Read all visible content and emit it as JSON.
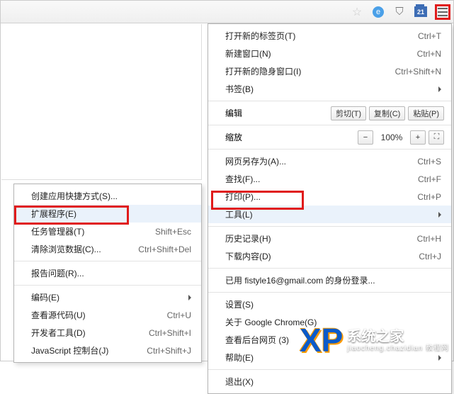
{
  "toolbar": {
    "calendar_num": "21"
  },
  "main": {
    "newtab": {
      "label": "打开新的标签页(T)",
      "shortcut": "Ctrl+T"
    },
    "newwin": {
      "label": "新建窗口(N)",
      "shortcut": "Ctrl+N"
    },
    "incog": {
      "label": "打开新的隐身窗口(I)",
      "shortcut": "Ctrl+Shift+N"
    },
    "bookmarks": {
      "label": "书签(B)"
    },
    "edit": {
      "label": "编辑",
      "cut": "剪切(T)",
      "copy": "复制(C)",
      "paste": "粘贴(P)"
    },
    "zoom": {
      "label": "缩放",
      "minus": "−",
      "pct": "100%",
      "plus": "+"
    },
    "saveas": {
      "label": "网页另存为(A)...",
      "shortcut": "Ctrl+S"
    },
    "find": {
      "label": "查找(F)...",
      "shortcut": "Ctrl+F"
    },
    "print": {
      "label": "打印(P)...",
      "shortcut": "Ctrl+P"
    },
    "tools": {
      "label": "工具(L)"
    },
    "history": {
      "label": "历史记录(H)",
      "shortcut": "Ctrl+H"
    },
    "downloads": {
      "label": "下载内容(D)",
      "shortcut": "Ctrl+J"
    },
    "signedin": {
      "label": "已用 fistyle16@gmail.com 的身份登录..."
    },
    "settings": {
      "label": "设置(S)"
    },
    "about": {
      "label": "关于 Google Chrome(G)"
    },
    "taskpage": {
      "label": "查看后台网页 (3)"
    },
    "help": {
      "label": "帮助(E)"
    },
    "exit": {
      "label": "退出(X)"
    }
  },
  "sub": {
    "shortcut": {
      "label": "创建应用快捷方式(S)..."
    },
    "extensions": {
      "label": "扩展程序(E)"
    },
    "taskmgr": {
      "label": "任务管理器(T)",
      "shortcut": "Shift+Esc"
    },
    "clear": {
      "label": "清除浏览数据(C)...",
      "shortcut": "Ctrl+Shift+Del"
    },
    "report": {
      "label": "报告问题(R)..."
    },
    "encoding": {
      "label": "编码(E)"
    },
    "viewsrc": {
      "label": "查看源代码(U)",
      "shortcut": "Ctrl+U"
    },
    "devtools": {
      "label": "开发者工具(D)",
      "shortcut": "Ctrl+Shift+I"
    },
    "jsconsole": {
      "label": "JavaScript 控制台(J)",
      "shortcut": "Ctrl+Shift+J"
    }
  },
  "watermark": {
    "big": "系统之家",
    "small": "jiaocheng.chazidian 教程网"
  }
}
